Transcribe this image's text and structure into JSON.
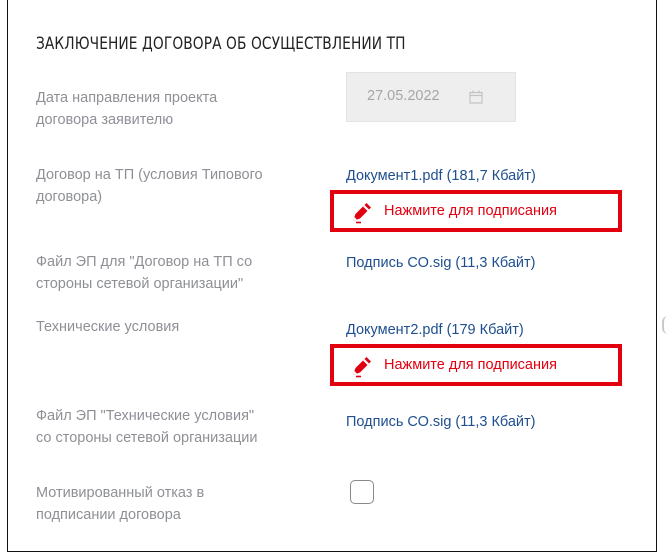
{
  "section": {
    "title": "ЗАКЛЮЧЕНИЕ ДОГОВОРА ОБ ОСУЩЕСТВЛЕНИИ ТП"
  },
  "fields": {
    "date_sent": {
      "label_line1": "Дата направления проекта",
      "label_line2": "договора заявителю",
      "value": "27.05.2022",
      "icon": "calendar-icon"
    },
    "contract": {
      "label_line1": "Договор на ТП (условия Типового",
      "label_line2": "договора)",
      "file": "Документ1.pdf (181,7 Кбайт)",
      "sign_label": "Нажмите для подписания"
    },
    "contract_sig": {
      "label_line1": "Файл ЭП для \"Договор на ТП со",
      "label_line2": "стороны сетевой организации\"",
      "file": "Подпись СО.sig (11,3 Кбайт)"
    },
    "tech_conditions": {
      "label": "Технические условия",
      "file": "Документ2.pdf (179 Кбайт)",
      "sign_label": "Нажмите для подписания"
    },
    "tech_sig": {
      "label_line1": "Файл ЭП \"Технические условия\"",
      "label_line2": "со стороны сетевой организации",
      "file": "Подпись СО.sig (11,3 Кбайт)"
    },
    "refusal": {
      "label_line1": "Мотивированный отказ в",
      "label_line2": "подписании договора",
      "checked": false
    }
  },
  "colors": {
    "link": "#1f4f8f",
    "highlight": "#e2000f",
    "label": "#8e9096"
  }
}
